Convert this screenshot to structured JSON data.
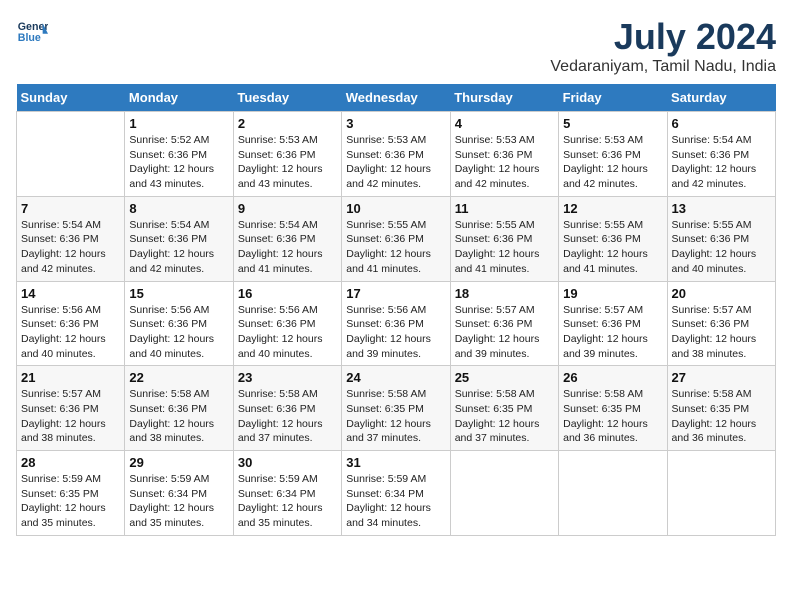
{
  "logo": {
    "line1": "General",
    "line2": "Blue"
  },
  "title": "July 2024",
  "subtitle": "Vedaraniyam, Tamil Nadu, India",
  "header_days": [
    "Sunday",
    "Monday",
    "Tuesday",
    "Wednesday",
    "Thursday",
    "Friday",
    "Saturday"
  ],
  "weeks": [
    [
      {
        "day": "",
        "info": ""
      },
      {
        "day": "1",
        "info": "Sunrise: 5:52 AM\nSunset: 6:36 PM\nDaylight: 12 hours\nand 43 minutes."
      },
      {
        "day": "2",
        "info": "Sunrise: 5:53 AM\nSunset: 6:36 PM\nDaylight: 12 hours\nand 43 minutes."
      },
      {
        "day": "3",
        "info": "Sunrise: 5:53 AM\nSunset: 6:36 PM\nDaylight: 12 hours\nand 42 minutes."
      },
      {
        "day": "4",
        "info": "Sunrise: 5:53 AM\nSunset: 6:36 PM\nDaylight: 12 hours\nand 42 minutes."
      },
      {
        "day": "5",
        "info": "Sunrise: 5:53 AM\nSunset: 6:36 PM\nDaylight: 12 hours\nand 42 minutes."
      },
      {
        "day": "6",
        "info": "Sunrise: 5:54 AM\nSunset: 6:36 PM\nDaylight: 12 hours\nand 42 minutes."
      }
    ],
    [
      {
        "day": "7",
        "info": "Sunrise: 5:54 AM\nSunset: 6:36 PM\nDaylight: 12 hours\nand 42 minutes."
      },
      {
        "day": "8",
        "info": "Sunrise: 5:54 AM\nSunset: 6:36 PM\nDaylight: 12 hours\nand 42 minutes."
      },
      {
        "day": "9",
        "info": "Sunrise: 5:54 AM\nSunset: 6:36 PM\nDaylight: 12 hours\nand 41 minutes."
      },
      {
        "day": "10",
        "info": "Sunrise: 5:55 AM\nSunset: 6:36 PM\nDaylight: 12 hours\nand 41 minutes."
      },
      {
        "day": "11",
        "info": "Sunrise: 5:55 AM\nSunset: 6:36 PM\nDaylight: 12 hours\nand 41 minutes."
      },
      {
        "day": "12",
        "info": "Sunrise: 5:55 AM\nSunset: 6:36 PM\nDaylight: 12 hours\nand 41 minutes."
      },
      {
        "day": "13",
        "info": "Sunrise: 5:55 AM\nSunset: 6:36 PM\nDaylight: 12 hours\nand 40 minutes."
      }
    ],
    [
      {
        "day": "14",
        "info": "Sunrise: 5:56 AM\nSunset: 6:36 PM\nDaylight: 12 hours\nand 40 minutes."
      },
      {
        "day": "15",
        "info": "Sunrise: 5:56 AM\nSunset: 6:36 PM\nDaylight: 12 hours\nand 40 minutes."
      },
      {
        "day": "16",
        "info": "Sunrise: 5:56 AM\nSunset: 6:36 PM\nDaylight: 12 hours\nand 40 minutes."
      },
      {
        "day": "17",
        "info": "Sunrise: 5:56 AM\nSunset: 6:36 PM\nDaylight: 12 hours\nand 39 minutes."
      },
      {
        "day": "18",
        "info": "Sunrise: 5:57 AM\nSunset: 6:36 PM\nDaylight: 12 hours\nand 39 minutes."
      },
      {
        "day": "19",
        "info": "Sunrise: 5:57 AM\nSunset: 6:36 PM\nDaylight: 12 hours\nand 39 minutes."
      },
      {
        "day": "20",
        "info": "Sunrise: 5:57 AM\nSunset: 6:36 PM\nDaylight: 12 hours\nand 38 minutes."
      }
    ],
    [
      {
        "day": "21",
        "info": "Sunrise: 5:57 AM\nSunset: 6:36 PM\nDaylight: 12 hours\nand 38 minutes."
      },
      {
        "day": "22",
        "info": "Sunrise: 5:58 AM\nSunset: 6:36 PM\nDaylight: 12 hours\nand 38 minutes."
      },
      {
        "day": "23",
        "info": "Sunrise: 5:58 AM\nSunset: 6:36 PM\nDaylight: 12 hours\nand 37 minutes."
      },
      {
        "day": "24",
        "info": "Sunrise: 5:58 AM\nSunset: 6:35 PM\nDaylight: 12 hours\nand 37 minutes."
      },
      {
        "day": "25",
        "info": "Sunrise: 5:58 AM\nSunset: 6:35 PM\nDaylight: 12 hours\nand 37 minutes."
      },
      {
        "day": "26",
        "info": "Sunrise: 5:58 AM\nSunset: 6:35 PM\nDaylight: 12 hours\nand 36 minutes."
      },
      {
        "day": "27",
        "info": "Sunrise: 5:58 AM\nSunset: 6:35 PM\nDaylight: 12 hours\nand 36 minutes."
      }
    ],
    [
      {
        "day": "28",
        "info": "Sunrise: 5:59 AM\nSunset: 6:35 PM\nDaylight: 12 hours\nand 35 minutes."
      },
      {
        "day": "29",
        "info": "Sunrise: 5:59 AM\nSunset: 6:34 PM\nDaylight: 12 hours\nand 35 minutes."
      },
      {
        "day": "30",
        "info": "Sunrise: 5:59 AM\nSunset: 6:34 PM\nDaylight: 12 hours\nand 35 minutes."
      },
      {
        "day": "31",
        "info": "Sunrise: 5:59 AM\nSunset: 6:34 PM\nDaylight: 12 hours\nand 34 minutes."
      },
      {
        "day": "",
        "info": ""
      },
      {
        "day": "",
        "info": ""
      },
      {
        "day": "",
        "info": ""
      }
    ]
  ]
}
